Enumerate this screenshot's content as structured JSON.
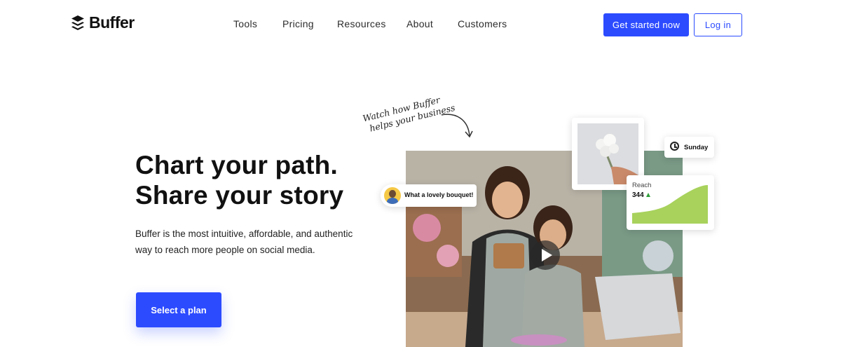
{
  "header": {
    "logo_text": "Buffer",
    "nav": [
      "Tools",
      "Pricing",
      "Resources",
      "About",
      "Customers"
    ],
    "cta_label": "Get started now",
    "login_label": "Log in"
  },
  "hero": {
    "title_line1": "Chart your path.",
    "title_line2": "Share your story",
    "description": "Buffer is the most intuitive, affordable, and authentic way to reach more people on social media.",
    "cta_label": "Select a plan"
  },
  "video_note": {
    "line1": "Watch how Buffer",
    "line2": "helps your business"
  },
  "cards": {
    "comment": "What a lovely bouquet!",
    "schedule_day": "Sunday",
    "reach_label": "Reach",
    "reach_value": "344"
  },
  "colors": {
    "brand_blue": "#2c4bff",
    "chart_green": "#a8d25c",
    "up_arrow": "#2e9e3a"
  }
}
